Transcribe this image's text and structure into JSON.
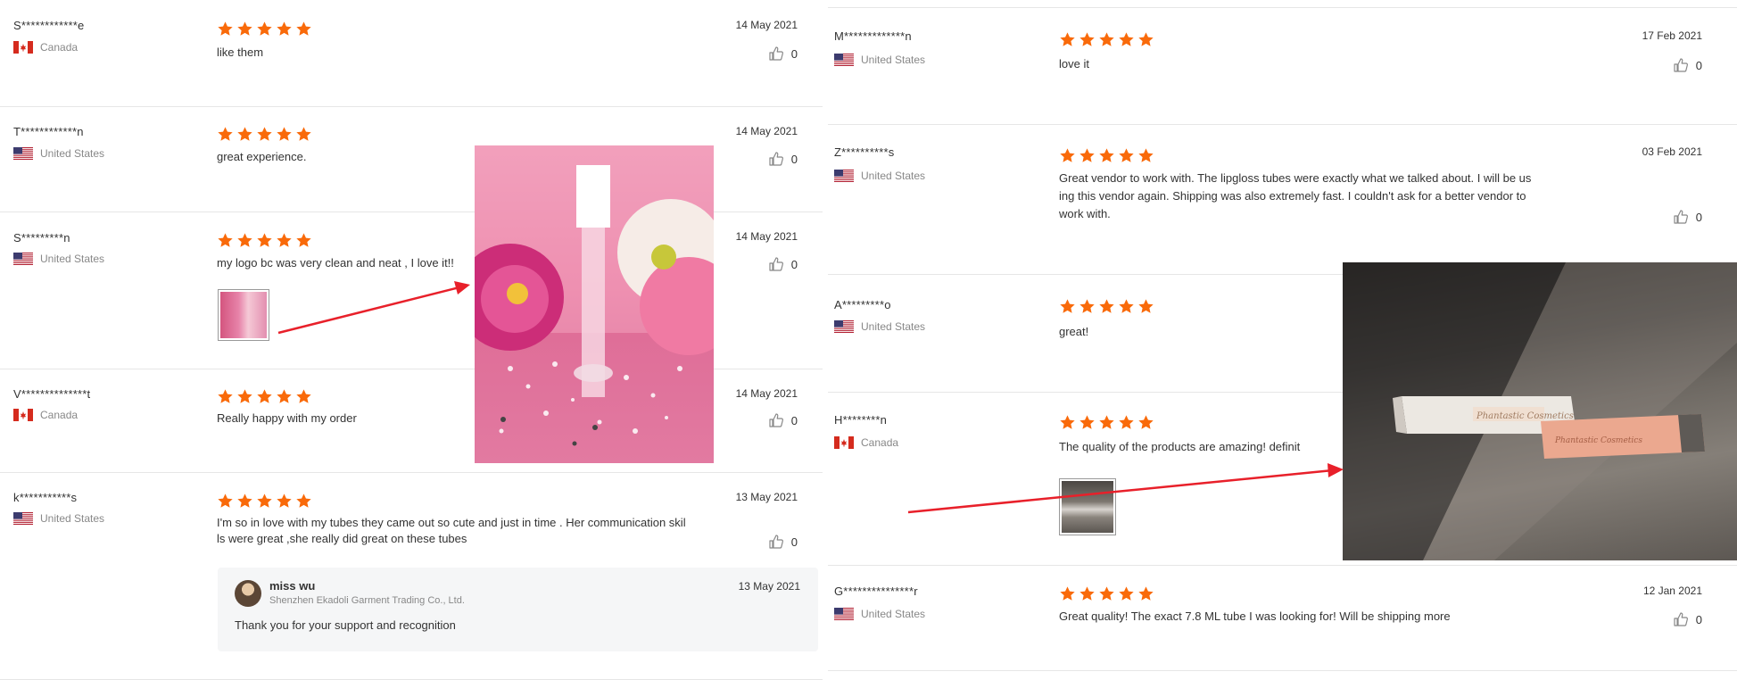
{
  "colors": {
    "star": "#f96a0a",
    "arrow": "#e8202a",
    "divider": "#e6e6e6",
    "muted": "#888888"
  },
  "left_reviews": [
    {
      "user": "S************e",
      "country": "Canada",
      "flag": "canada",
      "text": "like them",
      "date": "14 May 2021",
      "likes": "0"
    },
    {
      "user": "T************n",
      "country": "United States",
      "flag": "usa",
      "text": "great experience.",
      "date": "14 May 2021",
      "likes": "0"
    },
    {
      "user": "S*********n",
      "country": "United States",
      "flag": "usa",
      "text": "my logo bc was very clean and neat , I love it!!",
      "date": "14 May 2021",
      "likes": "0"
    },
    {
      "user": "V**************t",
      "country": "Canada",
      "flag": "canada",
      "text": "Really happy with my order",
      "date": "14 May 2021",
      "likes": "0"
    },
    {
      "user": "k***********s",
      "country": "United States",
      "flag": "usa",
      "text_line1": "I'm so in love with my tubes they came out so cute and just in time . Her communication skil",
      "text_line2": "ls were great ,she really did great on these tubes",
      "date": "13 May 2021",
      "likes": "0"
    }
  ],
  "seller_reply": {
    "name": "miss wu",
    "company": "Shenzhen Ekadoli Garment Trading Co., Ltd.",
    "date": "13 May 2021",
    "text": "Thank you for your support and recognition"
  },
  "right_reviews": [
    {
      "user": "M*************n",
      "country": "United States",
      "flag": "usa",
      "text": "love it",
      "date": "17 Feb 2021",
      "likes": "0"
    },
    {
      "user": "Z**********s",
      "country": "United States",
      "flag": "usa",
      "text_line1": "Great vendor to work with. The lipgloss tubes were exactly what we talked about. I will be us",
      "text_line2": "ing this vendor again. Shipping was also extremely fast. I couldn't ask for a better vendor to",
      "text_line3": "work with.",
      "date": "03 Feb 2021",
      "likes": "0"
    },
    {
      "user": "A*********o",
      "country": "United States",
      "flag": "usa",
      "text": "great!",
      "date": "",
      "likes": ""
    },
    {
      "user": "H********n",
      "country": "Canada",
      "flag": "canada",
      "text": "The quality of the products are amazing! definit",
      "date": "",
      "likes": ""
    },
    {
      "user": "G***************r",
      "country": "United States",
      "flag": "usa",
      "text": "Great quality! The exact 7.8 ML tube I was looking for! Will be shipping more",
      "date": "12 Jan 2021",
      "likes": "0"
    }
  ],
  "photo_right_labels": {
    "box_text": "Phantastic Cosmetics",
    "tube_text": "Phantastic Cosmetics"
  },
  "ratings": {
    "max": 5,
    "value": 5
  }
}
